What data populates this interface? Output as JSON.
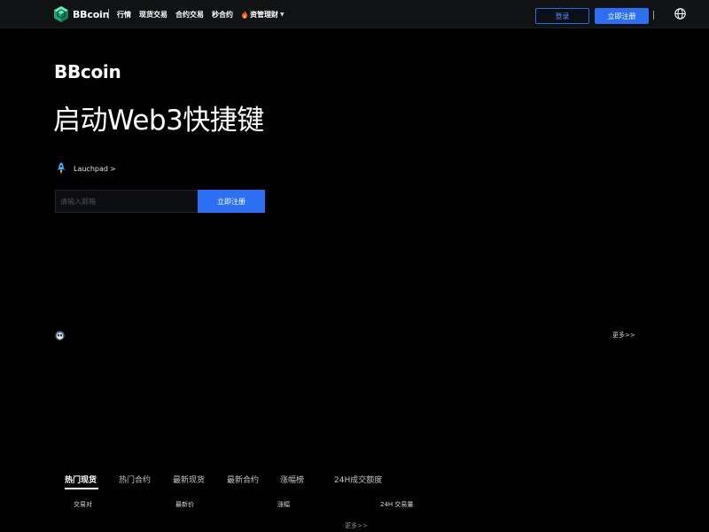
{
  "header": {
    "logo_text": "BBcoin",
    "nav": [
      {
        "label": "行情"
      },
      {
        "label": "现货交易"
      },
      {
        "label": "合约交易"
      },
      {
        "label": "秒合约"
      },
      {
        "label": "资管理财",
        "icon": "fire-icon",
        "has_dropdown": true
      }
    ],
    "login_label": "登录",
    "register_label": "立即注册",
    "globe_icon": "globe-icon"
  },
  "hero": {
    "brand": "BBcoin",
    "title": "启动Web3快捷键",
    "launchpad_label": "Lauchpad",
    "launchpad_chevron": ">",
    "email_placeholder": "请输入邮箱",
    "register_label": "立即注册"
  },
  "announcement": {
    "icon": "announcement-icon",
    "more_label": "更多>>"
  },
  "market": {
    "tabs": [
      {
        "label": "热门现货",
        "active": true
      },
      {
        "label": "热门合约",
        "active": false
      },
      {
        "label": "最新现货",
        "active": false
      },
      {
        "label": "最新合约",
        "active": false
      },
      {
        "label": "涨幅榜",
        "active": false
      },
      {
        "label": "24H成交额度",
        "active": false
      }
    ],
    "columns": [
      "交易对",
      "最新价",
      "涨幅",
      "24H 交易量"
    ],
    "more_label": "更多>>"
  },
  "colors": {
    "background": "#000000",
    "header_bg": "#111213",
    "accent_blue": "#2c6ff5",
    "logo_green": "#2fd69a"
  }
}
